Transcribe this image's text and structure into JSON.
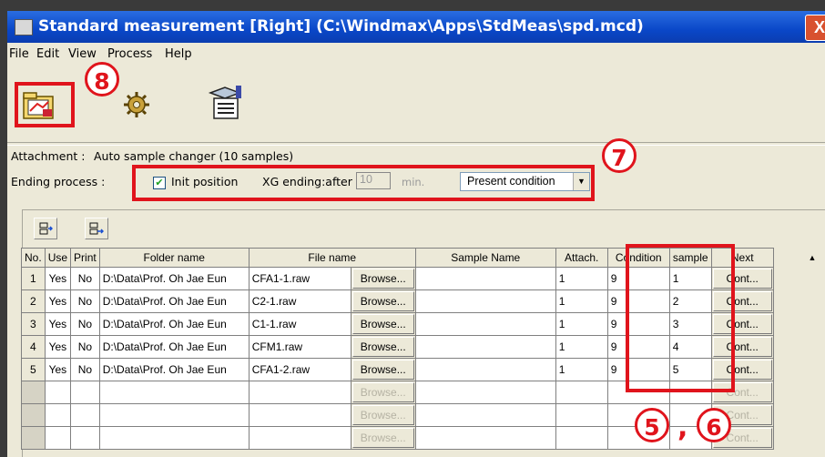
{
  "window": {
    "title": "Standard measurement [Right] (C:\\Windmax\\Apps\\StdMeas\\spd.mcd)",
    "close_glyph": "X"
  },
  "menu": [
    "File",
    "Edit",
    "View",
    "Process",
    "Help"
  ],
  "toolbar": {
    "icons": [
      "measurement-folder-icon",
      "process-gear-icon",
      "report-icon"
    ]
  },
  "settings": {
    "attachment_label": "Attachment :",
    "attachment_value": "Auto sample changer (10 samples)",
    "ending_label": "Ending process :",
    "init_position_label": "Init position",
    "init_position_checked": true,
    "xg_ending_label": "XG ending:after",
    "xg_value": "10",
    "xg_unit": "min.",
    "condition_select": "Present condition"
  },
  "grid": {
    "headers": [
      "No.",
      "Use",
      "Print",
      "Folder name",
      "File name",
      "",
      "Sample Name",
      "Attach.",
      "Condition",
      "sample",
      "Next"
    ],
    "browse_label": "Browse...",
    "cont_label": "Cont...",
    "rows": [
      {
        "no": "1",
        "use": "Yes",
        "print": "No",
        "folder": "D:\\Data\\Prof. Oh Jae Eun",
        "file": "CFA1-1.raw",
        "sample_name": "",
        "attach": "1",
        "condition": "9",
        "sample": "1"
      },
      {
        "no": "2",
        "use": "Yes",
        "print": "No",
        "folder": "D:\\Data\\Prof. Oh Jae Eun",
        "file": "C2-1.raw",
        "sample_name": "",
        "attach": "1",
        "condition": "9",
        "sample": "2"
      },
      {
        "no": "3",
        "use": "Yes",
        "print": "No",
        "folder": "D:\\Data\\Prof. Oh Jae Eun",
        "file": "C1-1.raw",
        "sample_name": "",
        "attach": "1",
        "condition": "9",
        "sample": "3"
      },
      {
        "no": "4",
        "use": "Yes",
        "print": "No",
        "folder": "D:\\Data\\Prof. Oh Jae Eun",
        "file": "CFM1.raw",
        "sample_name": "",
        "attach": "1",
        "condition": "9",
        "sample": "4"
      },
      {
        "no": "5",
        "use": "Yes",
        "print": "No",
        "folder": "D:\\Data\\Prof. Oh Jae Eun",
        "file": "CFA1-2.raw",
        "sample_name": "",
        "attach": "1",
        "condition": "9",
        "sample": "5"
      }
    ],
    "empty_rows": 3
  },
  "annotations": {
    "callout_8": "8",
    "callout_7": "7",
    "callout_5": "5",
    "callout_6": "6",
    "comma": ",",
    "color": "#e0141c"
  }
}
